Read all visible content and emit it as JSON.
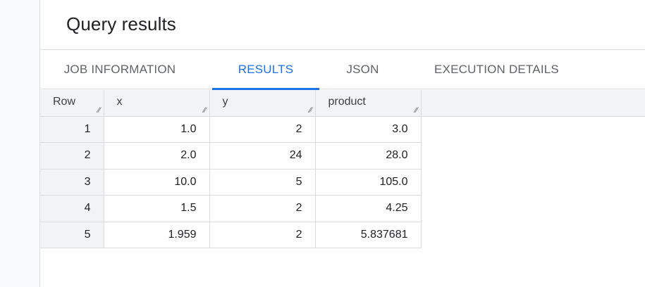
{
  "panel": {
    "title": "Query results"
  },
  "tabs": [
    {
      "label": "JOB INFORMATION",
      "active": false
    },
    {
      "label": "RESULTS",
      "active": true
    },
    {
      "label": "JSON",
      "active": false
    },
    {
      "label": "EXECUTION DETAILS",
      "active": false
    }
  ],
  "colors": {
    "accent": "#1a73e8",
    "header_bg": "#f1f3f4",
    "border": "#dadce0"
  },
  "table": {
    "columns": [
      "Row",
      "x",
      "y",
      "product"
    ],
    "resize_icon": "column-resize-icon",
    "rows": [
      {
        "row": "1",
        "x": "1.0",
        "y": "2",
        "product": "3.0"
      },
      {
        "row": "2",
        "x": "2.0",
        "y": "24",
        "product": "28.0"
      },
      {
        "row": "3",
        "x": "10.0",
        "y": "5",
        "product": "105.0"
      },
      {
        "row": "4",
        "x": "1.5",
        "y": "2",
        "product": "4.25"
      },
      {
        "row": "5",
        "x": "1.959",
        "y": "2",
        "product": "5.837681"
      }
    ]
  }
}
